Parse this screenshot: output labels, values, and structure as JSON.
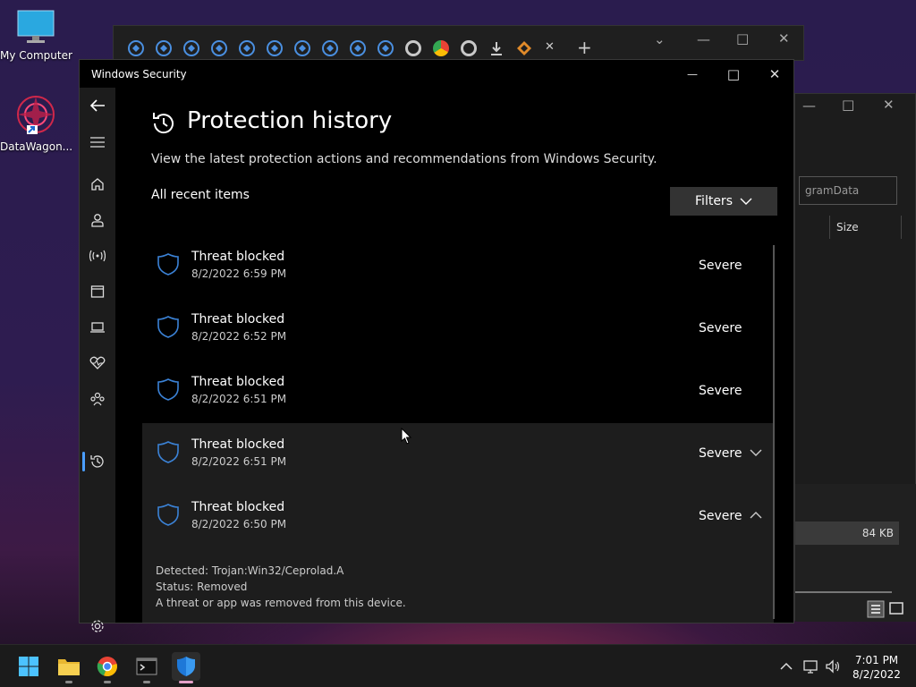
{
  "desktop": {
    "icons": [
      {
        "label": "My Computer"
      },
      {
        "label": "DataWagon..."
      }
    ]
  },
  "window": {
    "title": "Windows Security",
    "minimize": "—",
    "maximize": "□",
    "close": "✕"
  },
  "page": {
    "title": "Protection history",
    "subtitle": "View the latest protection actions and recommendations from Windows Security.",
    "section": "All recent items",
    "filters_label": "Filters"
  },
  "items": [
    {
      "title": "Threat blocked",
      "time": "8/2/2022 6:59 PM",
      "severity": "Severe"
    },
    {
      "title": "Threat blocked",
      "time": "8/2/2022 6:52 PM",
      "severity": "Severe"
    },
    {
      "title": "Threat blocked",
      "time": "8/2/2022 6:51 PM",
      "severity": "Severe"
    },
    {
      "title": "Threat blocked",
      "time": "8/2/2022 6:51 PM",
      "severity": "Severe"
    },
    {
      "title": "Threat blocked",
      "time": "8/2/2022 6:50 PM",
      "severity": "Severe",
      "detected": "Detected:  Trojan:Win32/Ceprolad.A",
      "status": "Status:  Removed",
      "message": "A threat or app was removed from this device."
    }
  ],
  "explorer_bg": {
    "address": "gramData",
    "col_size": "Size",
    "file_size": "84 KB"
  },
  "taskbar": {
    "time": "7:01 PM",
    "date": "8/2/2022"
  },
  "colors": {
    "accent": "#4a9eff",
    "shield": "#3b82d6"
  }
}
